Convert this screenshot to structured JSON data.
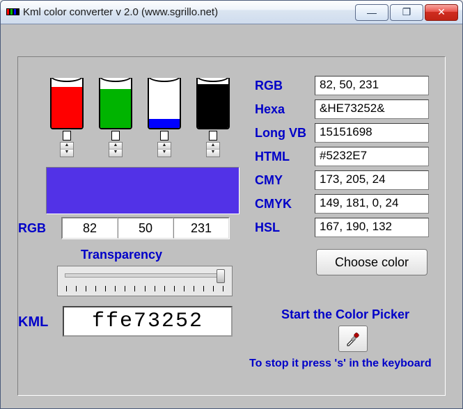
{
  "window": {
    "title": "Kml color converter v 2.0 (www.sgrillo.net)"
  },
  "bottles": {
    "red_fill_pct": 82,
    "green_fill_pct": 78,
    "blue_fill_pct": 18,
    "black_fill_pct": 88,
    "colors": {
      "red": "#ff0000",
      "green": "#00b400",
      "blue": "#0000ff",
      "black": "#000000"
    }
  },
  "swatch_color": "#5232E7",
  "rgb_label": "RGB",
  "rgb_values": {
    "r": "82",
    "g": "50",
    "b": "231"
  },
  "transparency": {
    "label": "Transparency",
    "value_pct": 100
  },
  "kml": {
    "label": "KML",
    "value": "ffe73252"
  },
  "readouts": {
    "rgb": {
      "label": "RGB",
      "value": "82, 50, 231"
    },
    "hexa": {
      "label": "Hexa",
      "value": "&HE73252&"
    },
    "longvb": {
      "label": "Long VB",
      "value": "15151698"
    },
    "html": {
      "label": "HTML",
      "value": "#5232E7"
    },
    "cmy": {
      "label": "CMY",
      "value": "173, 205, 24"
    },
    "cmyk": {
      "label": "CMYK",
      "value": "149, 181, 0, 24"
    },
    "hsl": {
      "label": "HSL",
      "value": "167, 190, 132"
    }
  },
  "choose_color_label": "Choose color",
  "color_picker": {
    "start_label": "Start the Color Picker",
    "stop_label": "To stop it press 's' in the keyboard"
  },
  "icons": {
    "minimize": "—",
    "maximize": "❐",
    "close": "✕"
  }
}
